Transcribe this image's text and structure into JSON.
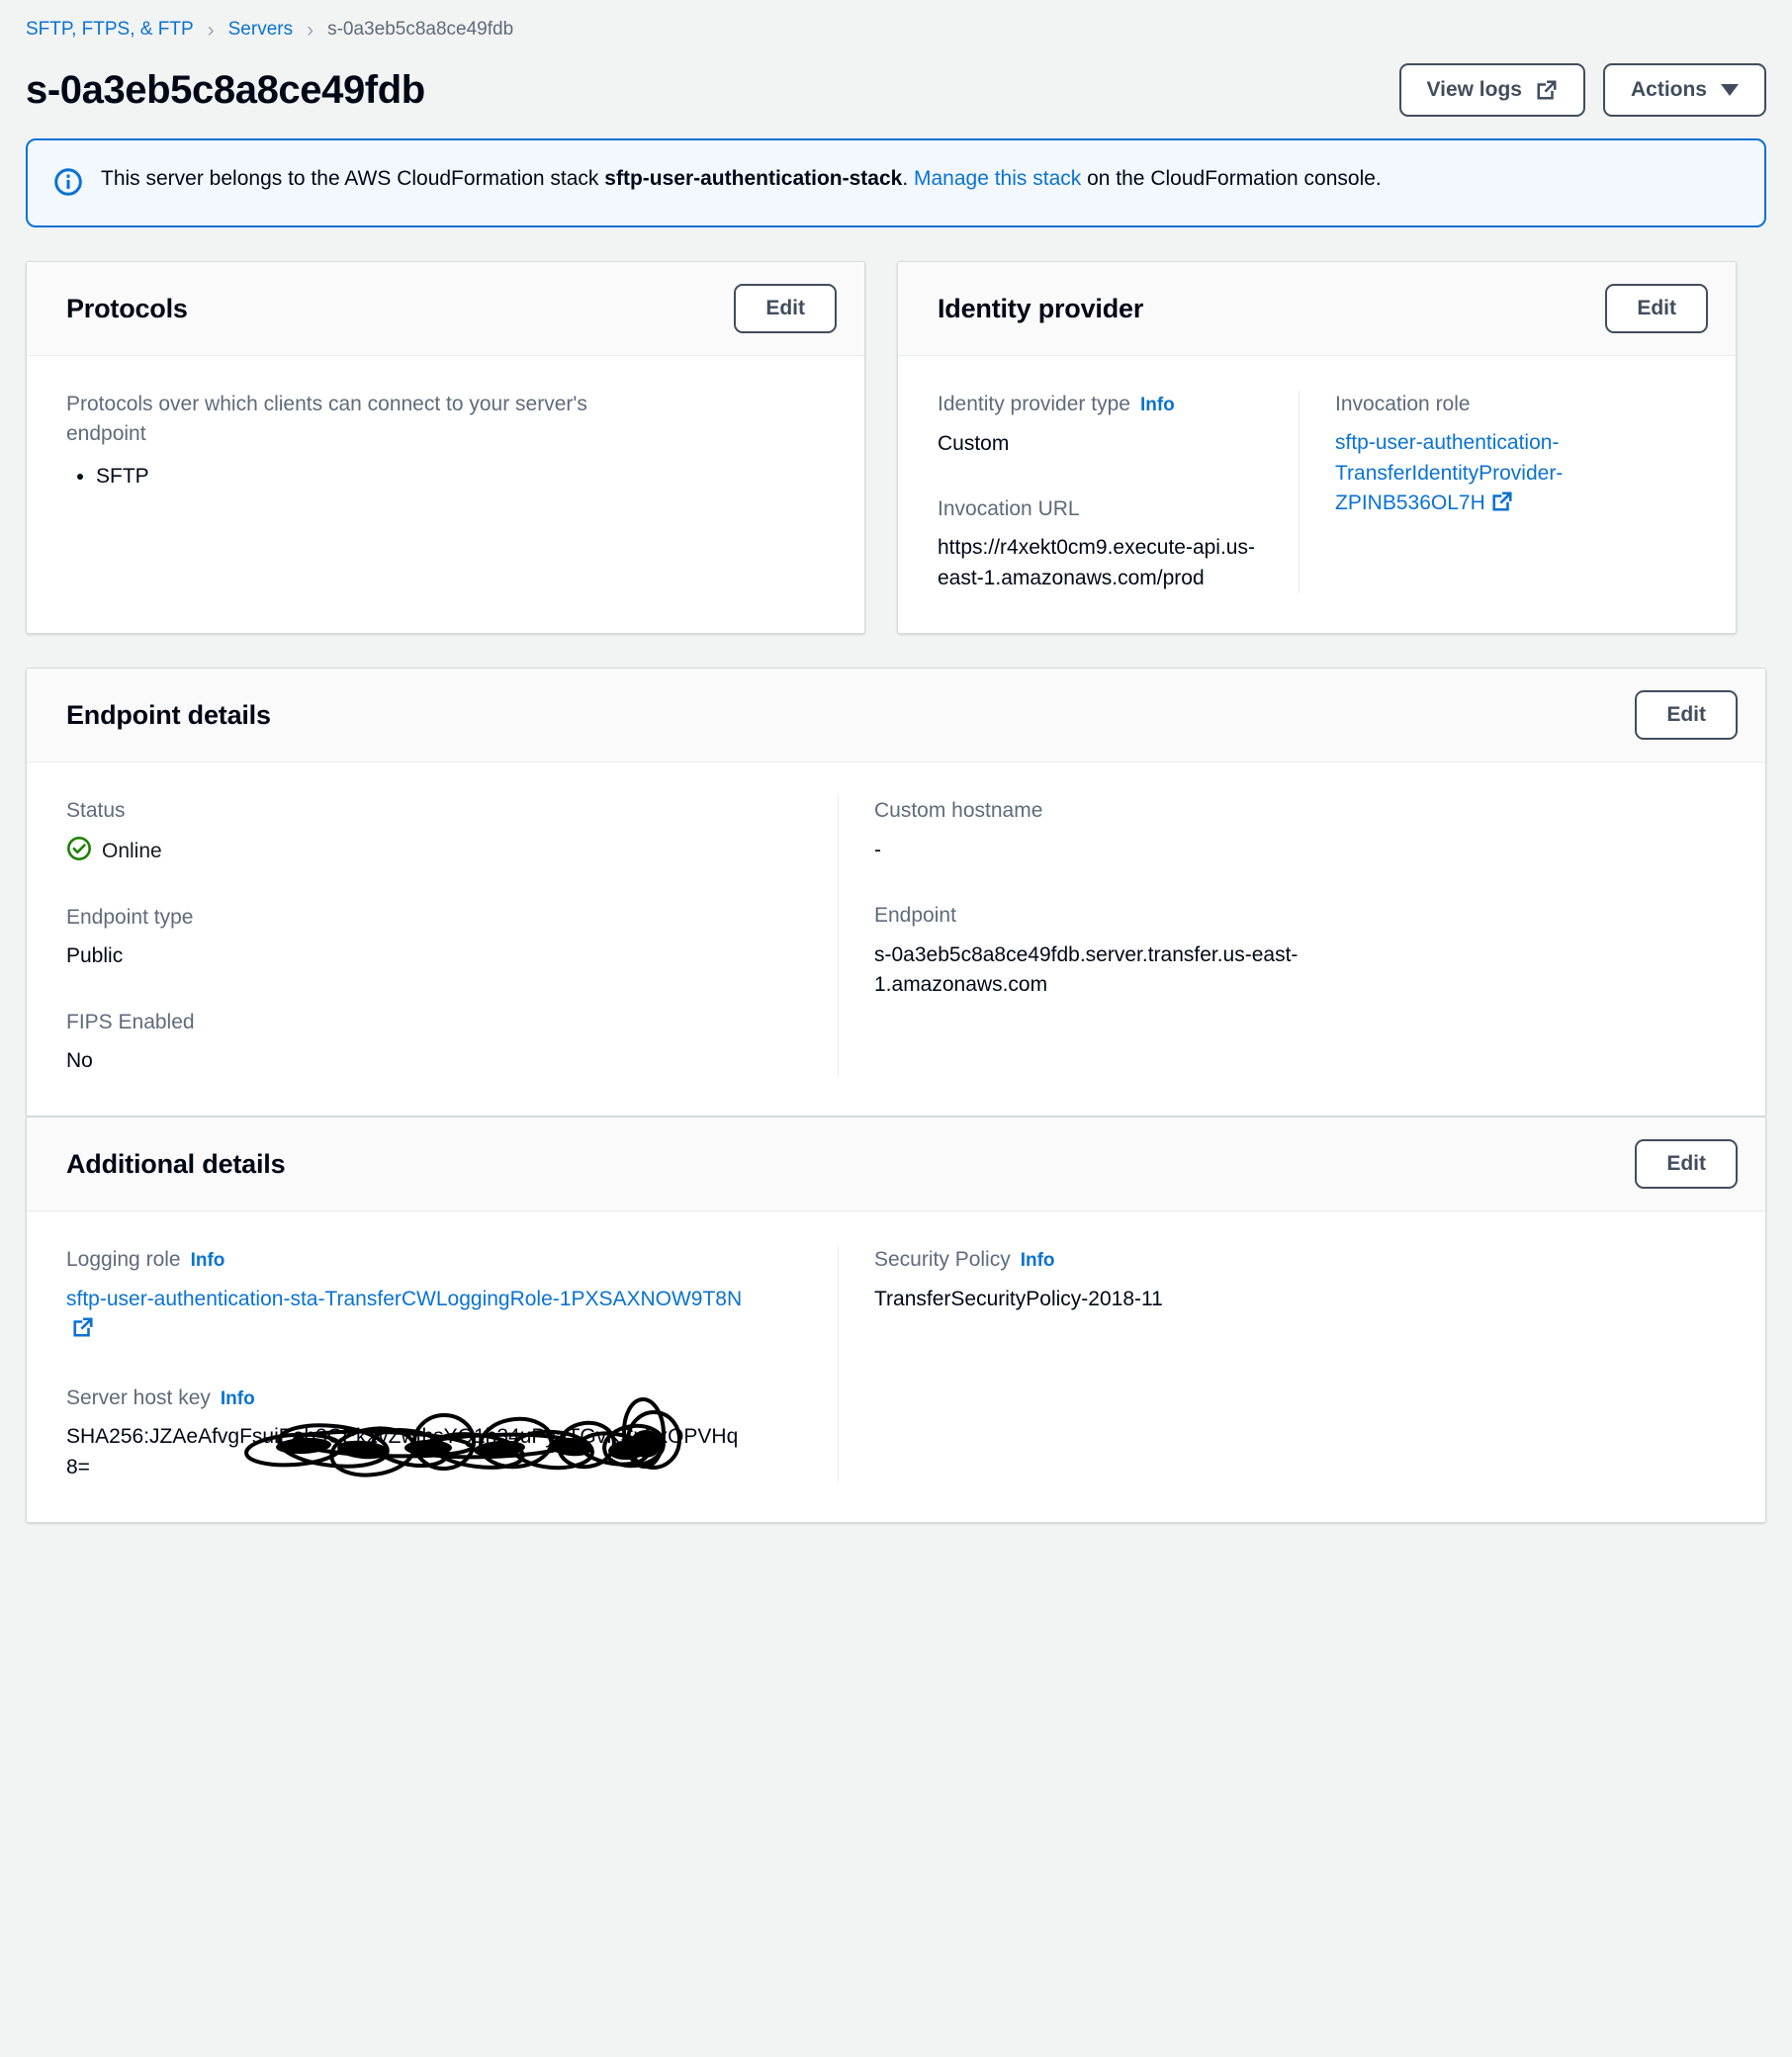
{
  "breadcrumb": {
    "items": [
      {
        "label": "SFTP, FTPS, & FTP",
        "type": "link"
      },
      {
        "label": "Servers",
        "type": "link"
      },
      {
        "label": "s-0a3eb5c8a8ce49fdb",
        "type": "current"
      }
    ],
    "separator": "›"
  },
  "header": {
    "title": "s-0a3eb5c8a8ce49fdb",
    "view_logs_label": "View logs",
    "actions_label": "Actions"
  },
  "alert": {
    "text_before": "This server belongs to the AWS CloudFormation stack ",
    "stack_name": "sftp-user-authentication-stack",
    "text_middle": ". ",
    "link_label": "Manage this stack",
    "text_after": " on the CloudFormation console."
  },
  "protocols": {
    "title": "Protocols",
    "edit_label": "Edit",
    "description": "Protocols over which clients can connect to your server's endpoint",
    "items": [
      "SFTP"
    ]
  },
  "identity_provider": {
    "title": "Identity provider",
    "edit_label": "Edit",
    "type_label": "Identity provider type",
    "type_info_label": "Info",
    "type_value": "Custom",
    "invocation_role_label": "Invocation role",
    "invocation_role_value": "sftp-user-authentication-TransferIdentityProvider-ZPINB536OL7H",
    "invocation_url_label": "Invocation URL",
    "invocation_url_value": "https://r4xekt0cm9.execute-api.us-east-1.amazonaws.com/prod"
  },
  "endpoint_details": {
    "title": "Endpoint details",
    "edit_label": "Edit",
    "status_label": "Status",
    "status_value": "Online",
    "endpoint_type_label": "Endpoint type",
    "endpoint_type_value": "Public",
    "fips_label": "FIPS Enabled",
    "fips_value": "No",
    "custom_hostname_label": "Custom hostname",
    "custom_hostname_value": "-",
    "endpoint_label": "Endpoint",
    "endpoint_value": "s-0a3eb5c8a8ce49fdb.server.transfer.us-east-1.amazonaws.com"
  },
  "additional_details": {
    "title": "Additional details",
    "edit_label": "Edit",
    "logging_role_label": "Logging role",
    "logging_role_info_label": "Info",
    "logging_role_value": "sftp-user-authentication-sta-TransferCWLoggingRole-1PXSAXNOW9T8N",
    "server_host_key_label": "Server host key",
    "server_host_key_info_label": "Info",
    "server_host_key_value": "SHA256:JZAeAfvgFsuiEeb3CEk2vZwthsYQ1h34uPyaTGvKSvZxOPVHq8=",
    "security_policy_label": "Security Policy",
    "security_policy_info_label": "Info",
    "security_policy_value": "TransferSecurityPolicy-2018-11"
  },
  "colors": {
    "link": "#0972d3",
    "text": "#000716",
    "muted": "#5f6b7a",
    "status_online": "#1d8102",
    "alert_bg": "#f2f8fd",
    "page_bg": "#f2f3f3"
  },
  "icons": {
    "external_link": "external-link-icon",
    "info": "info-circle-icon",
    "status_ok": "status-success-icon",
    "caret": "chevron-down-icon"
  }
}
